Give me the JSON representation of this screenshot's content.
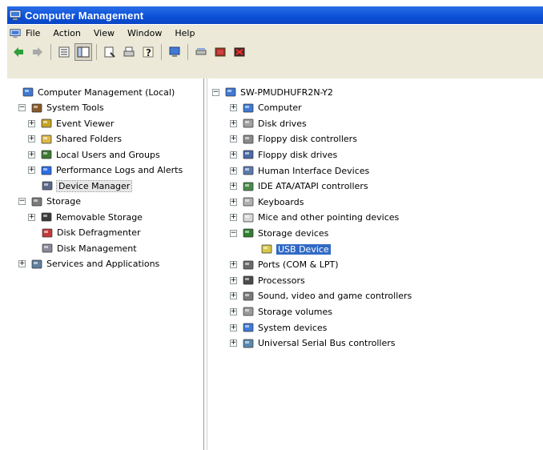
{
  "window": {
    "title": "Computer Management"
  },
  "menu": [
    "File",
    "Action",
    "View",
    "Window",
    "Help"
  ],
  "toolbar": {
    "buttons": [
      "back-icon",
      "forward-icon",
      "up-icon",
      "show-hide-tree-icon",
      "properties-icon",
      "print-icon",
      "help-icon",
      "monitor-icon",
      "scan-hardware-icon",
      "disable-icon",
      "uninstall-icon"
    ]
  },
  "left_tree": [
    {
      "label": "Computer Management (Local)",
      "name": "computer-management-local",
      "icon": "computer-mgmt-icon",
      "indent": 0,
      "exp": ""
    },
    {
      "label": "System Tools",
      "name": "system-tools",
      "icon": "tools-icon",
      "indent": 1,
      "exp": "-"
    },
    {
      "label": "Event Viewer",
      "name": "event-viewer",
      "icon": "event-viewer-icon",
      "indent": 2,
      "exp": "+"
    },
    {
      "label": "Shared Folders",
      "name": "shared-folders",
      "icon": "shared-folder-icon",
      "indent": 2,
      "exp": "+"
    },
    {
      "label": "Local Users and Groups",
      "name": "local-users-groups",
      "icon": "users-icon",
      "indent": 2,
      "exp": "+"
    },
    {
      "label": "Performance Logs and Alerts",
      "name": "performance-logs",
      "icon": "performance-icon",
      "indent": 2,
      "exp": "+"
    },
    {
      "label": "Device Manager",
      "name": "device-manager",
      "icon": "device-manager-icon",
      "indent": 2,
      "exp": "",
      "state": "hl"
    },
    {
      "label": "Storage",
      "name": "storage",
      "icon": "storage-icon",
      "indent": 1,
      "exp": "-"
    },
    {
      "label": "Removable Storage",
      "name": "removable-storage",
      "icon": "removable-storage-icon",
      "indent": 2,
      "exp": "+"
    },
    {
      "label": "Disk Defragmenter",
      "name": "disk-defragmenter",
      "icon": "defrag-icon",
      "indent": 2,
      "exp": ""
    },
    {
      "label": "Disk Management",
      "name": "disk-management",
      "icon": "disk-management-icon",
      "indent": 2,
      "exp": ""
    },
    {
      "label": "Services and Applications",
      "name": "services-applications",
      "icon": "services-icon",
      "indent": 1,
      "exp": "+"
    }
  ],
  "right_tree": [
    {
      "label": "SW-PMUDHUFR2N-Y2",
      "name": "computer-node",
      "icon": "computer-icon",
      "indent": 0,
      "exp": "-"
    },
    {
      "label": "Computer",
      "name": "computer",
      "icon": "computer-icon",
      "indent": 1,
      "exp": "+"
    },
    {
      "label": "Disk drives",
      "name": "disk-drives",
      "icon": "disk-drive-icon",
      "indent": 1,
      "exp": "+"
    },
    {
      "label": "Floppy disk controllers",
      "name": "floppy-disk-controllers",
      "icon": "floppy-controller-icon",
      "indent": 1,
      "exp": "+"
    },
    {
      "label": "Floppy disk drives",
      "name": "floppy-disk-drives",
      "icon": "floppy-drive-icon",
      "indent": 1,
      "exp": "+"
    },
    {
      "label": "Human Interface Devices",
      "name": "human-interface-devices",
      "icon": "hid-icon",
      "indent": 1,
      "exp": "+"
    },
    {
      "label": "IDE ATA/ATAPI controllers",
      "name": "ide-controllers",
      "icon": "ide-controller-icon",
      "indent": 1,
      "exp": "+"
    },
    {
      "label": "Keyboards",
      "name": "keyboards",
      "icon": "keyboard-icon",
      "indent": 1,
      "exp": "+"
    },
    {
      "label": "Mice and other pointing devices",
      "name": "mice-pointing-devices",
      "icon": "mouse-icon",
      "indent": 1,
      "exp": "+"
    },
    {
      "label": "Storage devices",
      "name": "storage-devices",
      "icon": "storage-device-icon",
      "indent": 1,
      "exp": "-"
    },
    {
      "label": "USB Device",
      "name": "usb-device",
      "icon": "usb-device-icon",
      "indent": 2,
      "exp": "",
      "state": "sel"
    },
    {
      "label": "Ports (COM & LPT)",
      "name": "ports-com-lpt",
      "icon": "port-icon",
      "indent": 1,
      "exp": "+"
    },
    {
      "label": "Processors",
      "name": "processors",
      "icon": "processor-icon",
      "indent": 1,
      "exp": "+"
    },
    {
      "label": "Sound, video and game controllers",
      "name": "sound-video-game-controllers",
      "icon": "sound-icon",
      "indent": 1,
      "exp": "+"
    },
    {
      "label": "Storage volumes",
      "name": "storage-volumes",
      "icon": "storage-volume-icon",
      "indent": 1,
      "exp": "+"
    },
    {
      "label": "System devices",
      "name": "system-devices",
      "icon": "system-devices-icon",
      "indent": 1,
      "exp": "+"
    },
    {
      "label": "Universal Serial Bus controllers",
      "name": "usb-controllers",
      "icon": "usb-controller-icon",
      "indent": 1,
      "exp": "+"
    }
  ]
}
